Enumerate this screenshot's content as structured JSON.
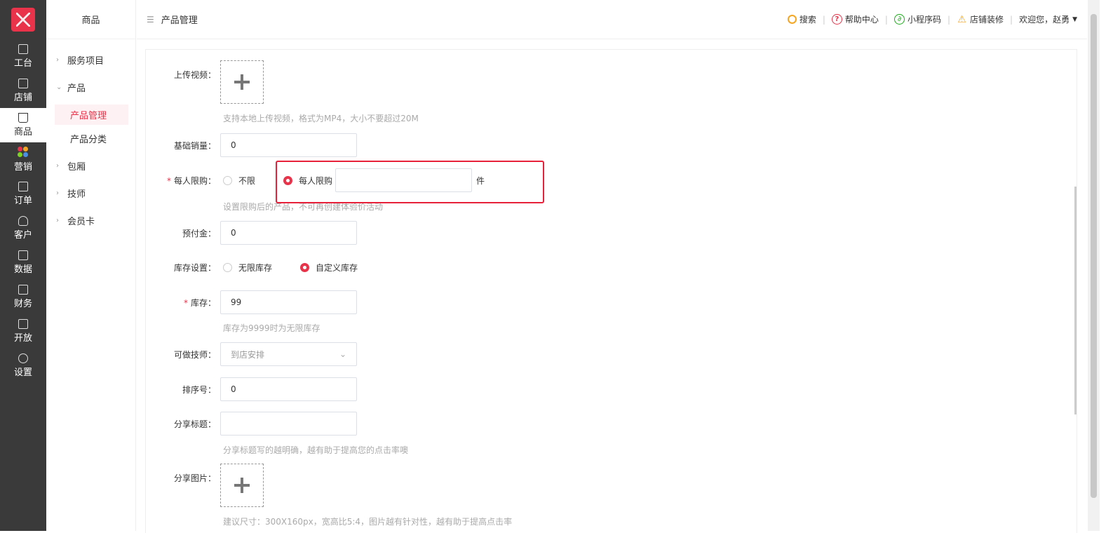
{
  "rail": {
    "items": [
      {
        "label": "工台",
        "icon": "monitor-icon"
      },
      {
        "label": "店铺",
        "icon": "store-icon"
      },
      {
        "label": "商品",
        "icon": "bag-icon",
        "active": true
      },
      {
        "label": "营销",
        "icon": "apps-icon"
      },
      {
        "label": "订单",
        "icon": "order-icon"
      },
      {
        "label": "客户",
        "icon": "user-icon"
      },
      {
        "label": "数据",
        "icon": "chart-icon"
      },
      {
        "label": "财务",
        "icon": "money-icon"
      },
      {
        "label": "开放",
        "icon": "code-icon"
      },
      {
        "label": "设置",
        "icon": "settings-icon"
      }
    ]
  },
  "sidebar": {
    "title": "商品",
    "groups": [
      {
        "label": "服务项目",
        "chevron": "›"
      },
      {
        "label": "产品",
        "chevron": "⌄"
      },
      {
        "label": "产品管理",
        "sub": true,
        "active": true
      },
      {
        "label": "产品分类",
        "sub": true
      },
      {
        "label": "包厢",
        "chevron": "›"
      },
      {
        "label": "技师",
        "chevron": "›"
      },
      {
        "label": "会员卡",
        "chevron": "›"
      }
    ]
  },
  "header": {
    "breadcrumb": "产品管理",
    "search": "搜索",
    "help": "帮助中心",
    "miniprogram": "小程序码",
    "decorate": "店铺装修",
    "welcome": "欢迎您，赵勇"
  },
  "form": {
    "upload_video_label": "上传视频：",
    "upload_video_hint": "支持本地上传视频，格式为MP4，大小不要超过20M",
    "base_sales_label": "基础销量：",
    "base_sales_value": "0",
    "limit_label": "每人限购：",
    "limit_unlimited": "不限",
    "limit_per_person": "每人限购",
    "limit_value": "",
    "limit_unit": "件",
    "limit_hint": "设置限购后的产品，不可再创建体验价活动",
    "deposit_label": "预付金：",
    "deposit_value": "0",
    "stock_setting_label": "库存设置：",
    "stock_unlimited": "无限库存",
    "stock_custom": "自定义库存",
    "stock_label": "库存：",
    "stock_value": "99",
    "stock_hint": "库存为9999时为无限库存",
    "tech_label": "可做技师：",
    "tech_value": "到店安排",
    "sort_label": "排序号：",
    "sort_value": "0",
    "share_title_label": "分享标题：",
    "share_title_value": "",
    "share_title_hint": "分享标题写的越明确，越有助于提高您的点击率噢",
    "share_image_label": "分享图片：",
    "share_image_hint": "建议尺寸：300X160px，宽高比5:4，图片越有针对性，越有助于提高点击率"
  },
  "colors": {
    "accent": "#e8334a",
    "rail_bg": "#3a3a3a"
  }
}
